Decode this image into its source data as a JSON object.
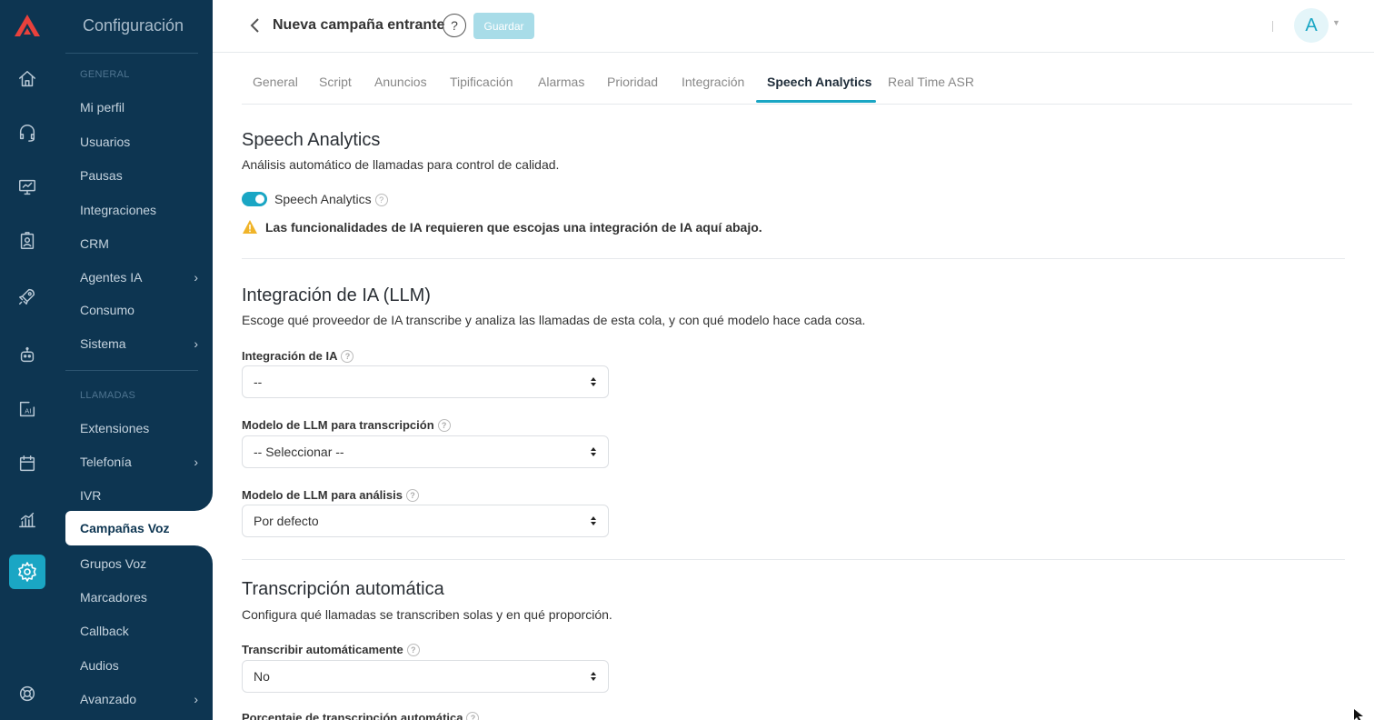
{
  "rail": {
    "icons": [
      "home-icon",
      "headset-icon",
      "monitor-icon",
      "badge-icon",
      "rocket-icon",
      "robot-icon",
      "ai-icon",
      "calendar-icon",
      "chart-icon",
      "settings-icon",
      "help-circle-icon"
    ],
    "active": "settings-icon"
  },
  "sidebar": {
    "title": "Configuración",
    "section_general": "GENERAL",
    "general_items": [
      {
        "label": "Mi perfil"
      },
      {
        "label": "Usuarios"
      },
      {
        "label": "Pausas"
      },
      {
        "label": "Integraciones"
      },
      {
        "label": "CRM"
      },
      {
        "label": "Agentes IA",
        "chevron": "›"
      },
      {
        "label": "Consumo"
      },
      {
        "label": "Sistema",
        "chevron": "›"
      }
    ],
    "section_calls": "LLAMADAS",
    "call_items": [
      {
        "label": "Extensiones"
      },
      {
        "label": "Telefonía",
        "chevron": "›"
      },
      {
        "label": "IVR"
      },
      {
        "label": "Campañas Voz"
      },
      {
        "label": "Grupos Voz"
      },
      {
        "label": "Marcadores"
      },
      {
        "label": "Callback"
      },
      {
        "label": "Audios"
      },
      {
        "label": "Avanzado",
        "chevron": "›"
      }
    ],
    "active_item": "Campañas Voz"
  },
  "header": {
    "title": "Nueva campaña entrante",
    "help_label": "?",
    "save_label": "Guardar",
    "avatar_initial": "A"
  },
  "tabs": {
    "items": [
      "General",
      "Script",
      "Anuncios",
      "Tipificación",
      "Alarmas",
      "Prioridad",
      "Integración",
      "Speech Analytics",
      "Real Time ASR"
    ],
    "active": "Speech Analytics"
  },
  "speech": {
    "title": "Speech Analytics",
    "description": "Análisis automático de llamadas para control de calidad.",
    "toggle_label": "Speech Analytics",
    "toggle_on": true,
    "warning": "Las funcionalidades de IA requieren que escojas una integración de IA aquí abajo."
  },
  "llm": {
    "title": "Integración de IA (LLM)",
    "description": "Escoge qué proveedor de IA transcribe y analiza las llamadas de esta cola, y con qué modelo hace cada cosa.",
    "integration_label": "Integración de IA",
    "integration_value": "--",
    "transcription_model_label": "Modelo de LLM para transcripción",
    "transcription_model_value": "-- Seleccionar --",
    "analysis_model_label": "Modelo de LLM para análisis",
    "analysis_model_value": "Por defecto"
  },
  "auto": {
    "title": "Transcripción automática",
    "description": "Configura qué llamadas se transcriben solas y en qué proporción.",
    "auto_label": "Transcribir automáticamente",
    "auto_value": "No",
    "percentage_label": "Porcentaje de transcripción automática"
  },
  "colors": {
    "sidebar_bg": "#0d3551",
    "accent": "#1aa6c4",
    "save_disabled": "#a8dce8",
    "warning": "#f0b429"
  }
}
